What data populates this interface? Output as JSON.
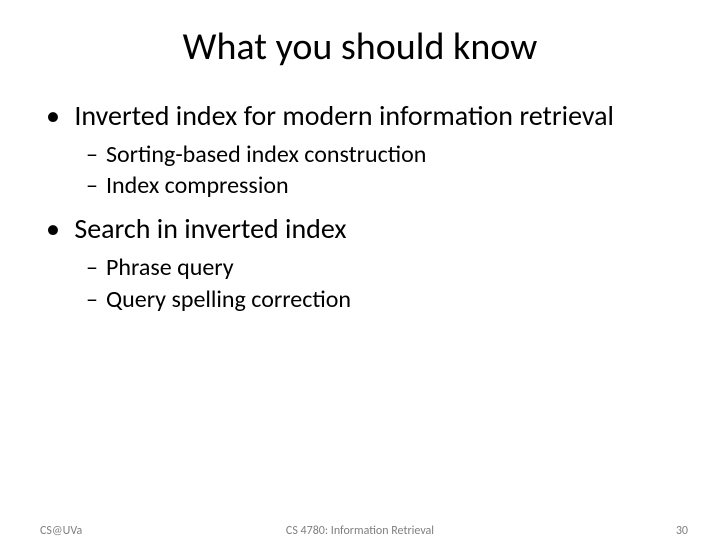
{
  "title": "What you should know",
  "bullets": [
    {
      "text": "Inverted index for modern information retrieval",
      "sub": [
        "Sorting-based index construction",
        "Index compression"
      ]
    },
    {
      "text": "Search in inverted index",
      "sub": [
        "Phrase query",
        "Query spelling correction"
      ]
    }
  ],
  "footer": {
    "left": "CS@UVa",
    "center": "CS 4780: Information Retrieval",
    "right": "30"
  }
}
